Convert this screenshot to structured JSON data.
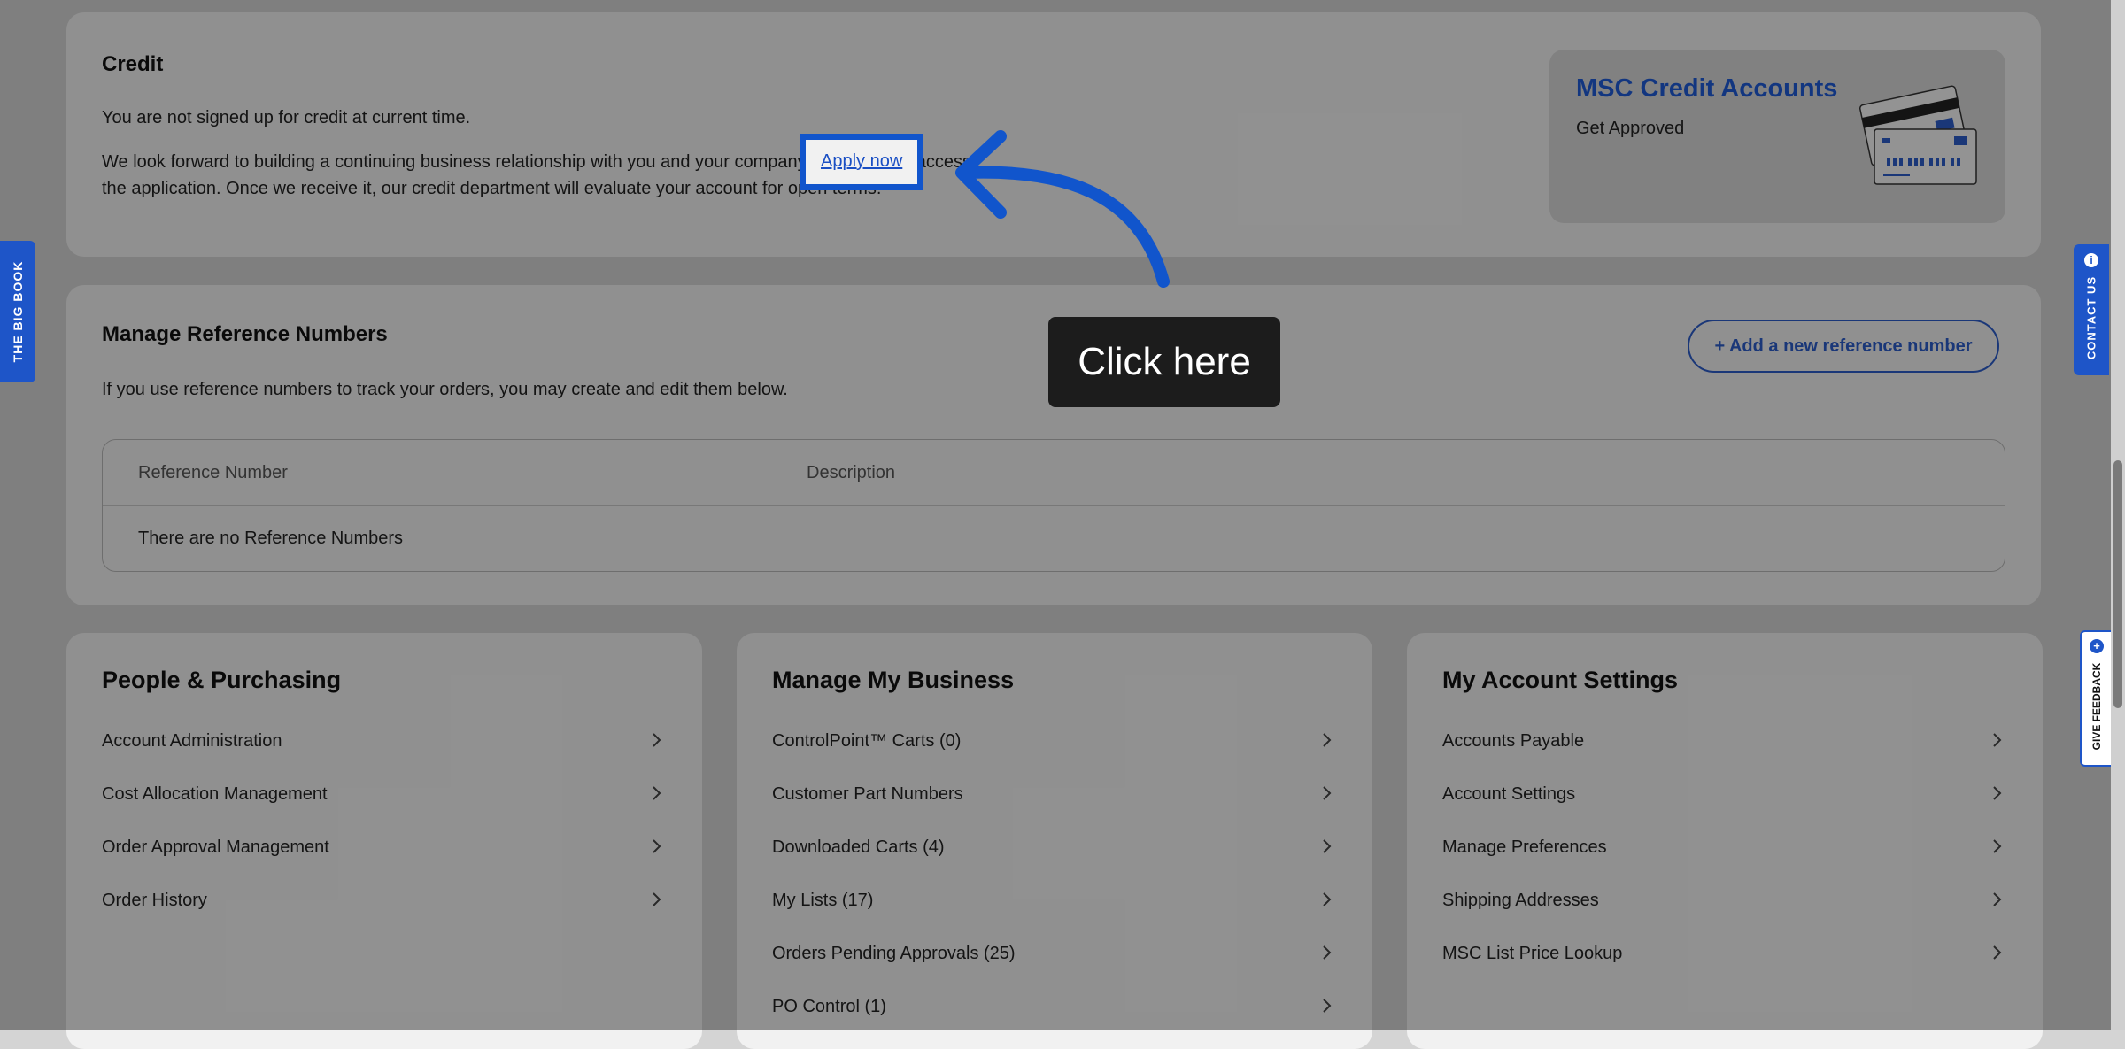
{
  "credit": {
    "title": "Credit",
    "status_text": "You are not signed up for credit at current time.",
    "body_line1_pre": "We look forward to building a continuing business relationship with you and your company.",
    "apply_link": "Apply now",
    "body_line1_post": " to access",
    "body_line2": "the application. Once we receive it, our credit department will evaluate your account for open terms."
  },
  "promo": {
    "title": "MSC Credit Accounts",
    "subtitle": "Get Approved",
    "icon": "credit-cards-illustration"
  },
  "references": {
    "title": "Manage Reference Numbers",
    "description": "If you use reference numbers to track your orders, you may create and edit them below.",
    "add_button": "+ Add a new reference number",
    "columns": [
      "Reference Number",
      "Description"
    ],
    "empty_text": "There are no Reference Numbers"
  },
  "people_purchasing": {
    "title": "People & Purchasing",
    "items": [
      "Account Administration",
      "Cost Allocation Management",
      "Order Approval Management",
      "Order History"
    ]
  },
  "manage_business": {
    "title": "Manage My Business",
    "items": [
      "ControlPoint™ Carts (0)",
      "Customer Part Numbers",
      "Downloaded Carts (4)",
      "My Lists (17)",
      "Orders Pending Approvals (25)",
      "PO Control (1)"
    ]
  },
  "account_settings": {
    "title": "My Account Settings",
    "items": [
      "Accounts Payable",
      "Account Settings",
      "Manage Preferences",
      "Shipping Addresses",
      "MSC List Price Lookup"
    ]
  },
  "side_tabs": {
    "big_book": "THE BIG BOOK",
    "contact_us": "CONTACT US",
    "feedback": "GIVE FEEDBACK"
  },
  "guide": {
    "tooltip": "Click here",
    "highlight_color": "#1155cc"
  },
  "colors": {
    "accent": "#1e55c8",
    "link": "#1a4fc4"
  }
}
